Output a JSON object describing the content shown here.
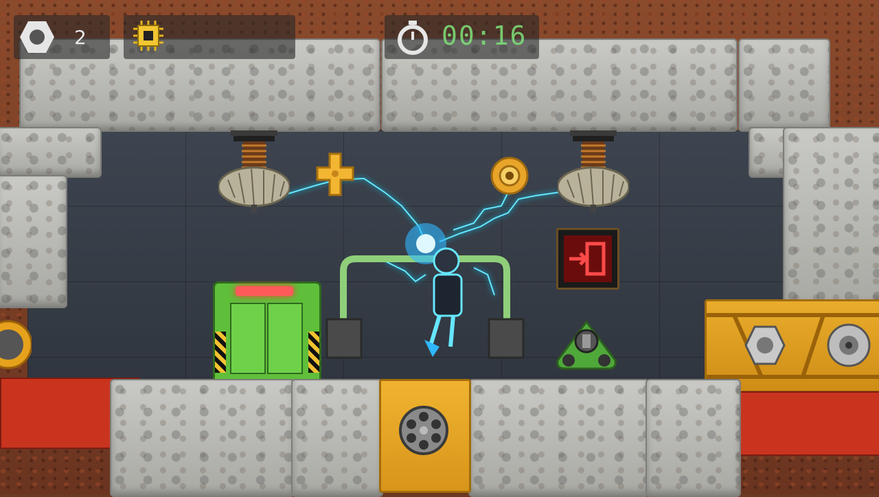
{
  "hud": {
    "hex_count": "2",
    "timer": "00:16",
    "icons": [
      "hex-nut-icon",
      "chip-icon",
      "stopwatch-icon"
    ]
  },
  "level": {
    "exit_sign_icon": "exit-door-icon",
    "colors": {
      "timer_green": "#7fe27a",
      "lightning": "#66e6ff",
      "exit_red": "#e21b1b",
      "door_green": "#5fbf3a",
      "beam_orange": "#e6a21c"
    }
  }
}
